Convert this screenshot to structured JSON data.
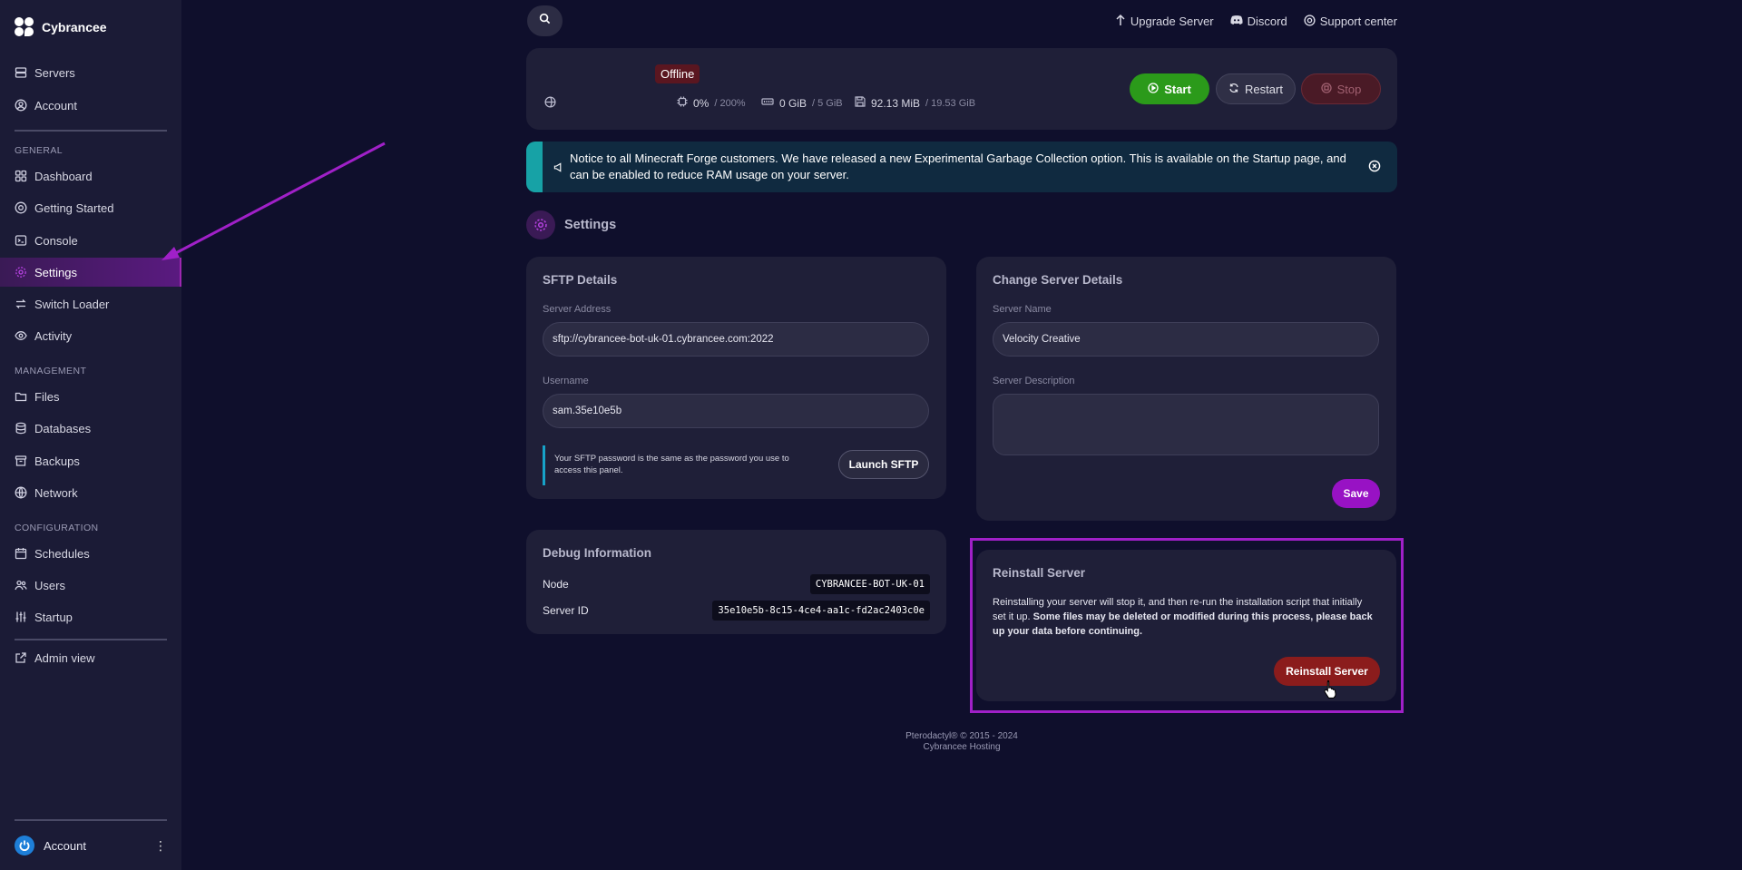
{
  "brand": {
    "name": "Cybrancee"
  },
  "sidebar": {
    "top_items": [
      {
        "label": "Servers",
        "icon": "server-icon"
      },
      {
        "label": "Account",
        "icon": "user-circle-icon"
      }
    ],
    "sections": [
      {
        "label": "GENERAL",
        "items": [
          {
            "label": "Dashboard",
            "icon": "grid-icon"
          },
          {
            "label": "Getting Started",
            "icon": "lifebuoy-icon"
          },
          {
            "label": "Console",
            "icon": "terminal-icon"
          },
          {
            "label": "Settings",
            "icon": "gear-icon",
            "active": true
          },
          {
            "label": "Switch Loader",
            "icon": "swap-icon"
          },
          {
            "label": "Activity",
            "icon": "eye-icon"
          }
        ]
      },
      {
        "label": "MANAGEMENT",
        "items": [
          {
            "label": "Files",
            "icon": "folder-icon"
          },
          {
            "label": "Databases",
            "icon": "database-icon"
          },
          {
            "label": "Backups",
            "icon": "archive-icon"
          },
          {
            "label": "Network",
            "icon": "globe-icon"
          }
        ]
      },
      {
        "label": "CONFIGURATION",
        "items": [
          {
            "label": "Schedules",
            "icon": "calendar-icon"
          },
          {
            "label": "Users",
            "icon": "users-icon"
          },
          {
            "label": "Startup",
            "icon": "sliders-icon"
          }
        ]
      }
    ],
    "admin_view": "Admin view",
    "account_label": "Account"
  },
  "topbar": {
    "links": [
      {
        "label": "Upgrade Server",
        "icon": "arrow-up-icon"
      },
      {
        "label": "Discord",
        "icon": "discord-icon"
      },
      {
        "label": "Support center",
        "icon": "lifebuoy-icon"
      }
    ]
  },
  "status": {
    "state": "Offline",
    "cpu": "0%",
    "cpu_limit": "/ 200%",
    "memory": "0 GiB",
    "memory_limit": "/ 5 GiB",
    "disk": "92.13 MiB",
    "disk_limit": "/ 19.53 GiB",
    "start": "Start",
    "restart": "Restart",
    "stop": "Stop"
  },
  "notice": {
    "text": "Notice to all Minecraft Forge customers. We have released a new Experimental Garbage Collection option. This is available on the Startup page, and can be enabled to reduce RAM usage on your server."
  },
  "page": {
    "title": "Settings"
  },
  "sftp": {
    "title": "SFTP Details",
    "address_label": "Server Address",
    "address": "sftp://cybrancee-bot-uk-01.cybrancee.com:2022",
    "username_label": "Username",
    "username": "sam.35e10e5b",
    "note": "Your SFTP password is the same as the password you use to access this panel.",
    "launch": "Launch SFTP"
  },
  "details": {
    "title": "Change Server Details",
    "name_label": "Server Name",
    "name": "Velocity Creative",
    "desc_label": "Server Description",
    "desc": "",
    "save": "Save"
  },
  "debug": {
    "title": "Debug Information",
    "node_label": "Node",
    "node": "CYBRANCEE-BOT-UK-01",
    "id_label": "Server ID",
    "id": "35e10e5b-8c15-4ce4-aa1c-fd2ac2403c0e"
  },
  "reinstall": {
    "title": "Reinstall Server",
    "text_plain": "Reinstalling your server will stop it, and then re-run the installation script that initially set it up.",
    "text_bold": "Some files may be deleted or modified during this process, please back up your data before continuing.",
    "button": "Reinstall Server"
  },
  "footer": {
    "line1": "Pterodactyl® © 2015 - 2024",
    "line2": "Cybrancee Hosting"
  },
  "colors": {
    "accent": "#9c27b0",
    "annotation": "#a020c8",
    "start": "#2b9a1a",
    "reinstall": "#8b1c1c"
  }
}
